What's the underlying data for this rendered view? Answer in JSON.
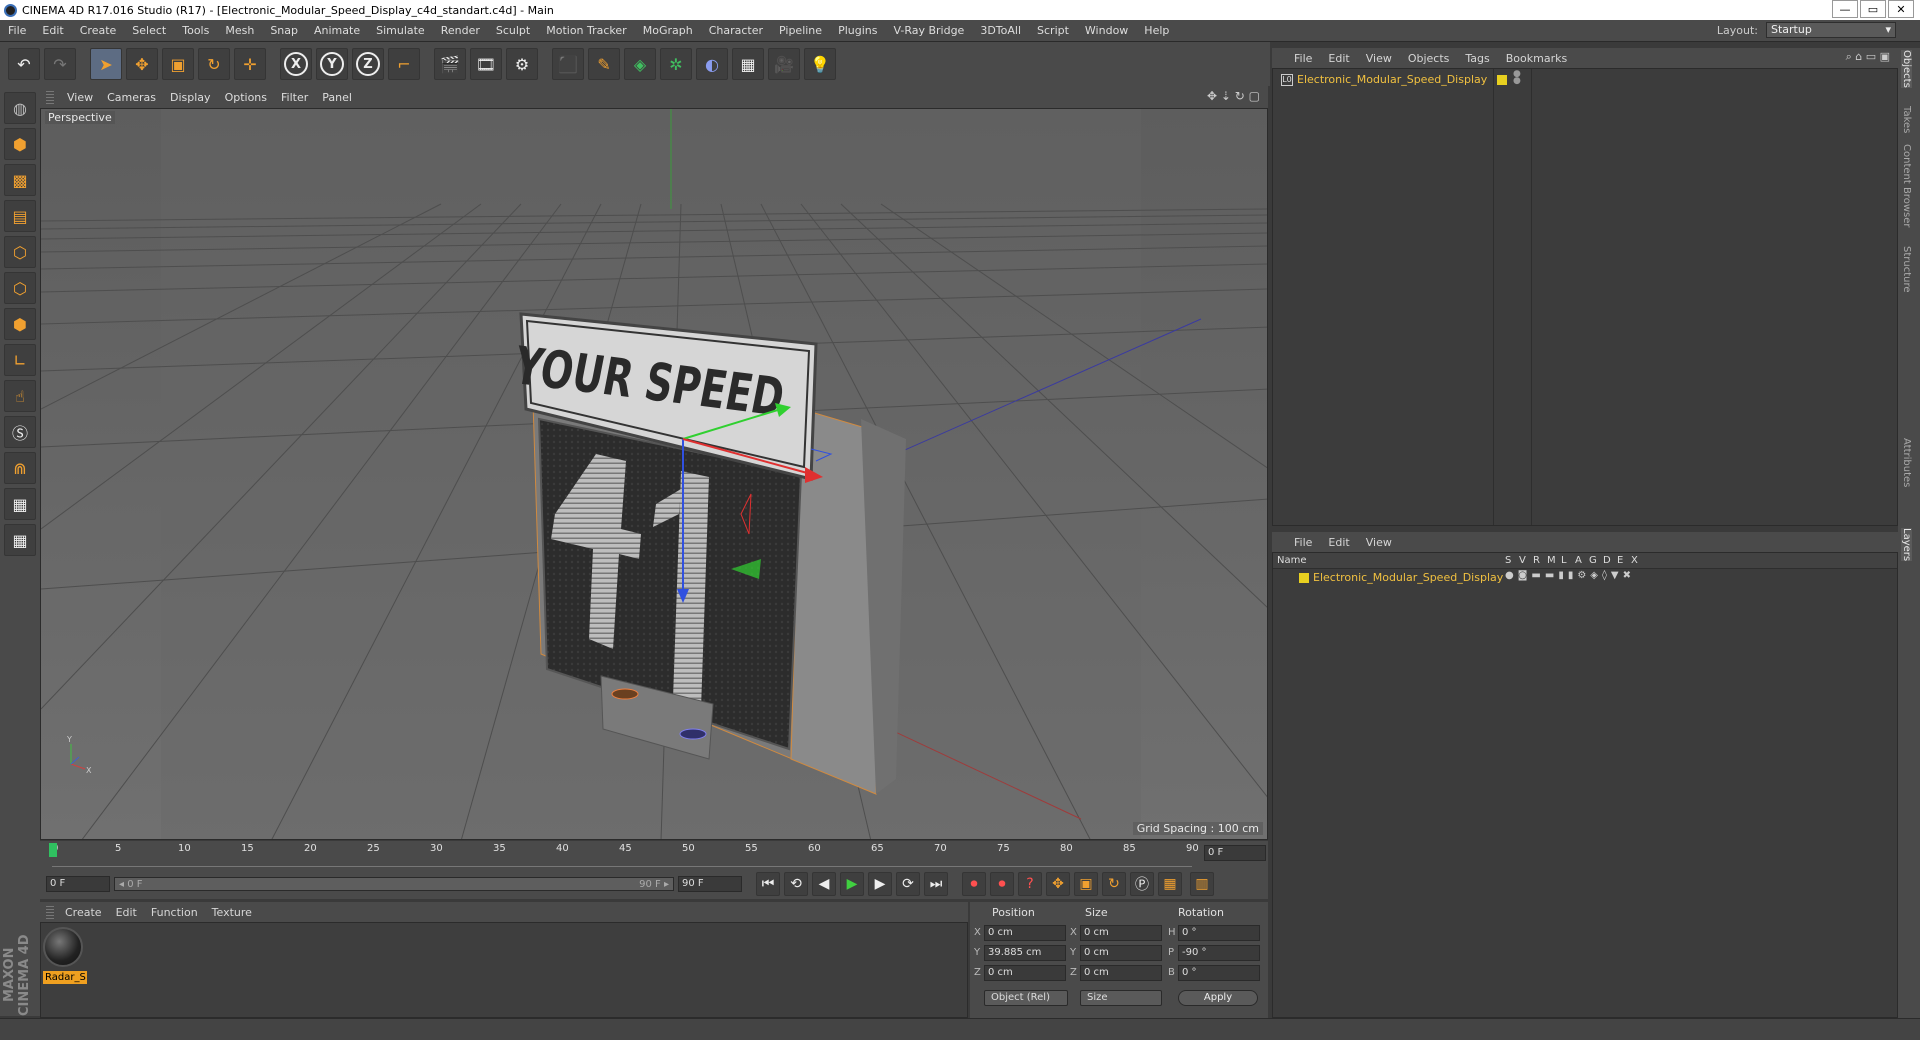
{
  "window": {
    "title": "CINEMA 4D R17.016 Studio (R17) - [Electronic_Modular_Speed_Display_c4d_standart.c4d] - Main",
    "buttons": [
      "—",
      "▭",
      "✕"
    ]
  },
  "menubar": [
    "File",
    "Edit",
    "Create",
    "Select",
    "Tools",
    "Mesh",
    "Snap",
    "Animate",
    "Simulate",
    "Render",
    "Sculpt",
    "Motion Tracker",
    "MoGraph",
    "Character",
    "Pipeline",
    "Plugins",
    "V-Ray Bridge",
    "3DToAll",
    "Script",
    "Window",
    "Help"
  ],
  "layout": {
    "label": "Layout:",
    "value": "Startup"
  },
  "toolbar": {
    "axes": [
      "X",
      "Y",
      "Z"
    ]
  },
  "viewport": {
    "menu": [
      "View",
      "Cameras",
      "Display",
      "Options",
      "Filter",
      "Panel"
    ],
    "camera_label": "Perspective",
    "grid_spacing": "Grid Spacing : 100 cm",
    "sign_text": "YOUR SPEED",
    "display_number": "41"
  },
  "timeline": {
    "ticks": [
      "0",
      "5",
      "10",
      "15",
      "20",
      "25",
      "30",
      "35",
      "40",
      "45",
      "50",
      "55",
      "60",
      "65",
      "70",
      "75",
      "80",
      "85",
      "90"
    ],
    "current_frame": "0 F",
    "start_field": "0 F",
    "range_start": "◂ 0 F",
    "range_end": "90 F ▸",
    "end_field": "90 F"
  },
  "material_manager": {
    "menu": [
      "Create",
      "Edit",
      "Function",
      "Texture"
    ],
    "material_name": "Radar_S"
  },
  "coordinates": {
    "headers": {
      "position": "Position",
      "size": "Size",
      "rotation": "Rotation"
    },
    "position": {
      "x": "0 cm",
      "y": "39.885 cm",
      "z": "0 cm"
    },
    "size": {
      "x": "0 cm",
      "y": "0 cm",
      "z": "0 cm"
    },
    "rotation": {
      "h": "0 °",
      "p": "-90 °",
      "b": "0 °"
    },
    "labels": {
      "x": "X",
      "y": "Y",
      "z": "Z",
      "h": "H",
      "p": "P",
      "b": "B"
    },
    "mode_dropdown": "Object (Rel)",
    "size_dropdown": "Size",
    "apply": "Apply"
  },
  "object_manager": {
    "menu": [
      "File",
      "Edit",
      "View",
      "Objects",
      "Tags",
      "Bookmarks"
    ],
    "object_name": "Electronic_Modular_Speed_Display",
    "layer_color": "#e8d020"
  },
  "layer_manager": {
    "menu": [
      "File",
      "Edit",
      "View"
    ],
    "columns": [
      "Name",
      "S",
      "V",
      "R",
      "M",
      "L",
      "A",
      "G",
      "D",
      "E",
      "X"
    ],
    "layer_name": "Electronic_Modular_Speed_Display"
  },
  "right_tabs": [
    "Objects",
    "Takes",
    "Content Browser",
    "Structure",
    "Attributes",
    "Layers"
  ],
  "branding": "MAXON CINEMA 4D"
}
